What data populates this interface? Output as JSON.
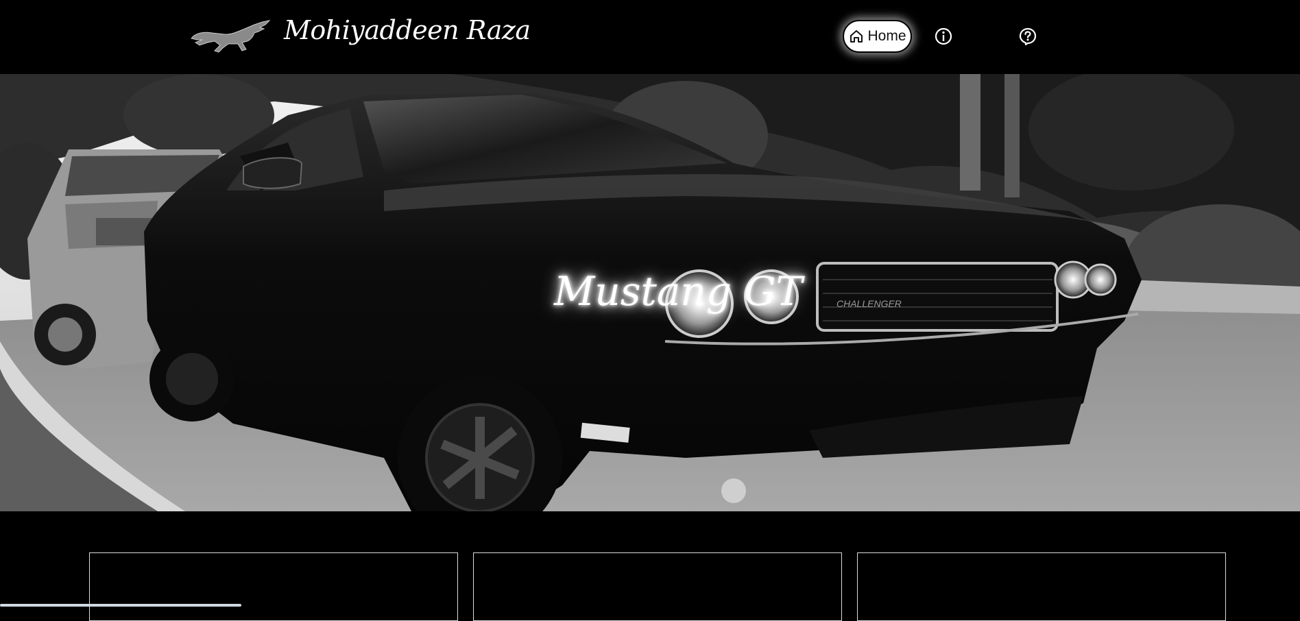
{
  "header": {
    "brand_name": "Mohiyaddeen Raza",
    "logo_icon": "mustang-horse-logo-icon",
    "nav": [
      {
        "label": "Home",
        "icon": "home-icon",
        "active": true
      },
      {
        "label": "",
        "icon": "info-icon",
        "active": false
      },
      {
        "label": "",
        "icon": "help-icon",
        "active": false
      }
    ]
  },
  "hero": {
    "title": "Mustang GT",
    "background": "black-and-white photo of a black muscle car parked on a street"
  },
  "cards": [
    {
      "name": "card-1"
    },
    {
      "name": "card-2"
    },
    {
      "name": "card-3"
    }
  ],
  "colors": {
    "background": "#000000",
    "text": "#ffffff",
    "active_nav_bg": "#ffffff"
  }
}
